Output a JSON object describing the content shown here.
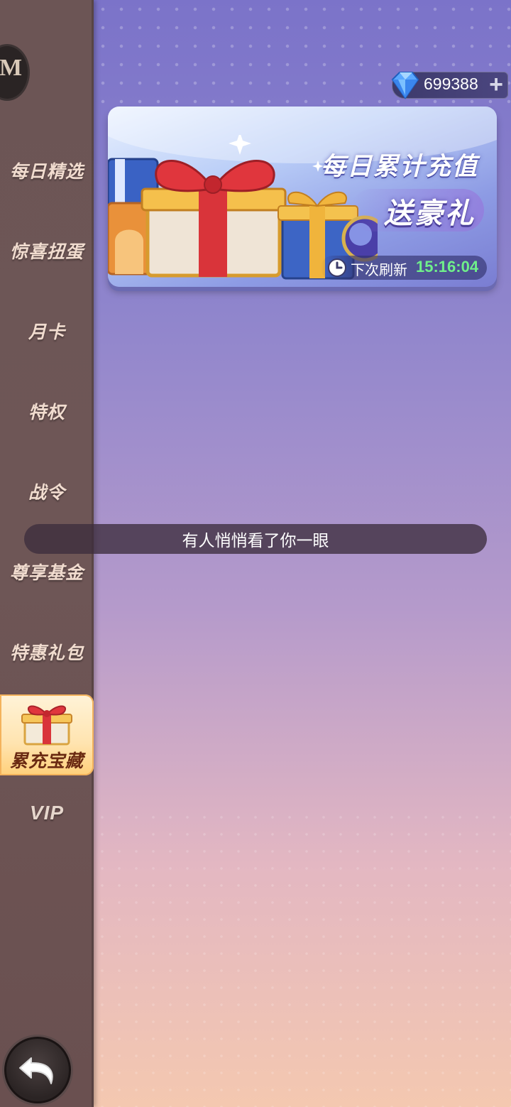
{
  "currency": {
    "amount": "699388",
    "icon": "diamond-icon",
    "add_symbol": "+"
  },
  "banner": {
    "title": "每日累计充值",
    "subtitle": "送豪礼",
    "refresh_label": "下次刷新",
    "refresh_time": "15:16:04"
  },
  "sidebar": {
    "items": [
      {
        "label": "每日精选"
      },
      {
        "label": "惊喜扭蛋"
      },
      {
        "label": "月卡"
      },
      {
        "label": "特权"
      },
      {
        "label": "战令"
      },
      {
        "label": "尊享基金"
      },
      {
        "label": "特惠礼包"
      },
      {
        "label": "累充宝藏",
        "active": true
      },
      {
        "label": "VIP"
      }
    ]
  },
  "toast": {
    "message": "有人悄悄看了你一眼"
  },
  "colors": {
    "refresh_time": "#6ff08a",
    "active_tab": "#ffe4b0"
  }
}
